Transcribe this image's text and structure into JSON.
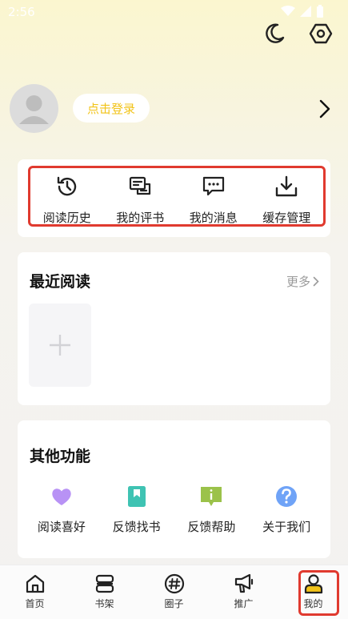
{
  "status_bar": {
    "time": "2:56"
  },
  "header": {
    "night_mode_icon": "moon-icon",
    "settings_icon": "hexagon-settings-icon"
  },
  "profile": {
    "login_label": "点击登录",
    "accent": "#f2c318"
  },
  "quick_actions": [
    {
      "label": "阅读历史",
      "icon": "history-icon"
    },
    {
      "label": "我的评书",
      "icon": "review-icon"
    },
    {
      "label": "我的消息",
      "icon": "message-icon"
    },
    {
      "label": "缓存管理",
      "icon": "download-icon"
    }
  ],
  "recent": {
    "title": "最近阅读",
    "more_label": "更多"
  },
  "other_functions": {
    "title": "其他功能",
    "items": [
      {
        "label": "阅读喜好",
        "icon": "heart-icon",
        "color": "#b892f5"
      },
      {
        "label": "反馈找书",
        "icon": "bookmark-icon",
        "color": "#3fc3b3"
      },
      {
        "label": "反馈帮助",
        "icon": "info-bubble-icon",
        "color": "#9bc24a"
      },
      {
        "label": "关于我们",
        "icon": "question-icon",
        "color": "#6fa3f7"
      }
    ]
  },
  "bottom_nav": [
    {
      "label": "首页",
      "icon": "home-icon"
    },
    {
      "label": "书架",
      "icon": "bookshelf-icon"
    },
    {
      "label": "圈子",
      "icon": "hashtag-icon"
    },
    {
      "label": "推广",
      "icon": "megaphone-icon"
    },
    {
      "label": "我的",
      "icon": "person-icon",
      "active": true
    }
  ],
  "highlight_color": "#e03a2f"
}
